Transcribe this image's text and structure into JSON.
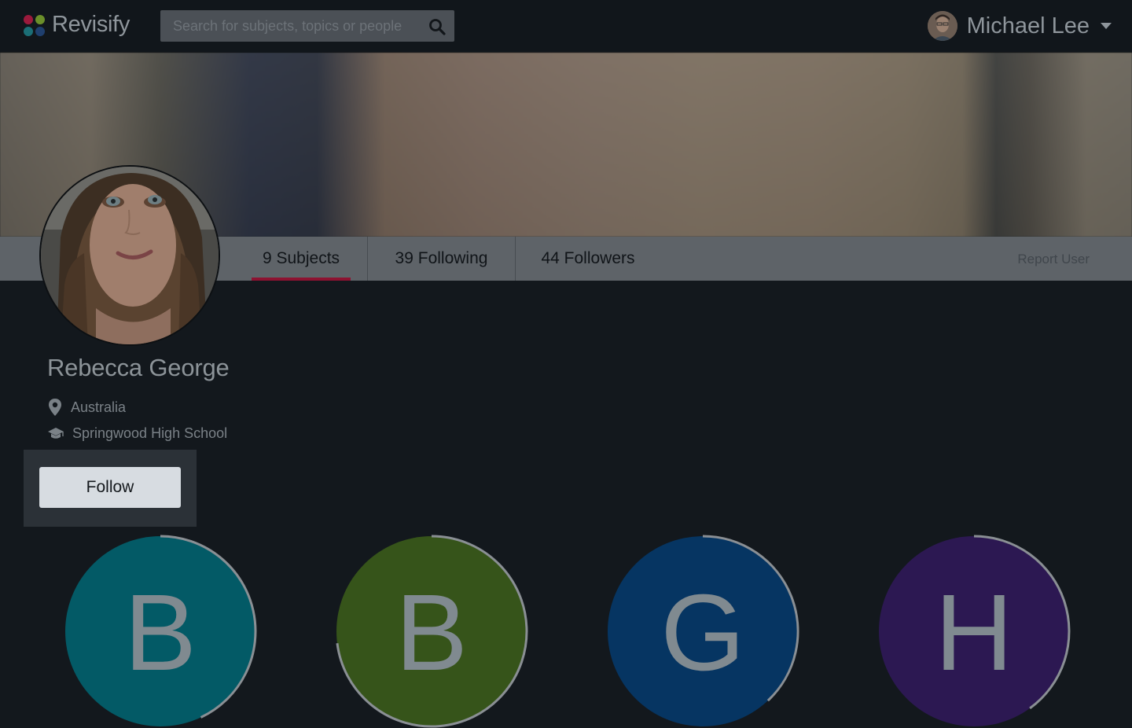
{
  "app": {
    "name": "Revisify",
    "logo_colors": [
      "#9b1a3c",
      "#6b8f2a",
      "#1f3f6e",
      "#1b6e76"
    ]
  },
  "search": {
    "placeholder": "Search for subjects, topics or people",
    "value": ""
  },
  "user_menu": {
    "name": "Michael Lee"
  },
  "profile": {
    "name": "Rebecca George",
    "location": "Australia",
    "school": "Springwood High School",
    "follow_label": "Follow"
  },
  "tabs": [
    {
      "label": "9 Subjects",
      "active": true
    },
    {
      "label": "39 Following",
      "active": false
    },
    {
      "label": "44 Followers",
      "active": false
    }
  ],
  "report_label": "Report User",
  "subjects": [
    {
      "letter": "B",
      "color": "#035a66",
      "progress": 0.43
    },
    {
      "letter": "B",
      "color": "#36541a",
      "progress": 0.73
    },
    {
      "letter": "G",
      "color": "#063562",
      "progress": 0.38
    },
    {
      "letter": "H",
      "color": "#2c1852",
      "progress": 0.4
    }
  ],
  "colors": {
    "active_tab_underline": "#8d1231",
    "progress_ring": "#8a8f94"
  }
}
